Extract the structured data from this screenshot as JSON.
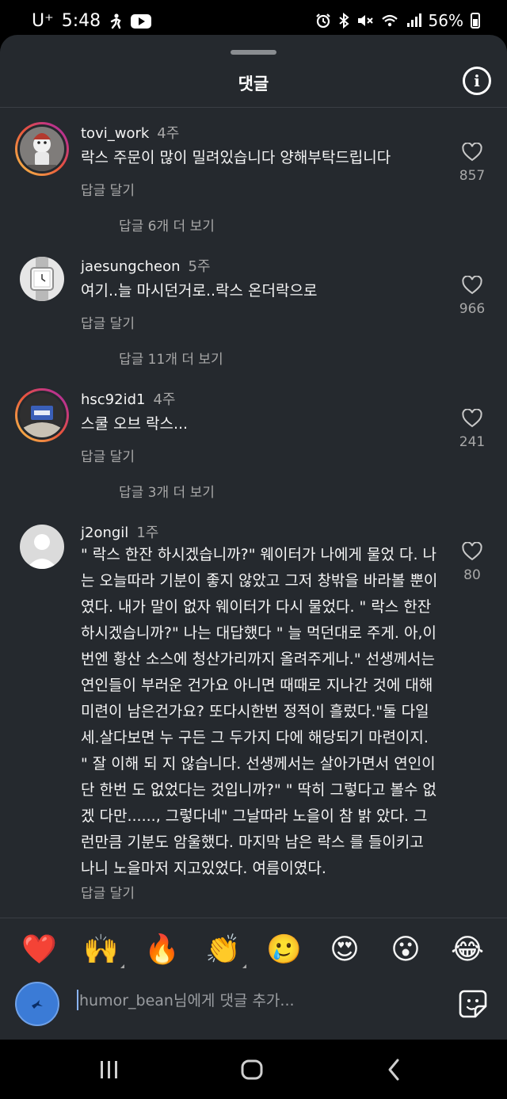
{
  "status_bar": {
    "carrier": "U⁺",
    "time": "5:48",
    "battery": "56%"
  },
  "sheet": {
    "title": "댓글"
  },
  "comments": [
    {
      "username": "tovi_work",
      "time": "4주",
      "text": "락스 주문이 많이 밀려있습니다 양해부탁드립니다",
      "reply_label": "답글 달기",
      "more_replies": "답글 6개 더 보기",
      "likes": "857"
    },
    {
      "username": "jaesungcheon",
      "time": "5주",
      "text": "여기..늘 마시던거로..락스 온더락으로",
      "reply_label": "답글 달기",
      "more_replies": "답글 11개 더 보기",
      "likes": "966"
    },
    {
      "username": "hsc92id1",
      "time": "4주",
      "text": "스쿨 오브 락스...",
      "reply_label": "답글 달기",
      "more_replies": "답글 3개 더 보기",
      "likes": "241"
    },
    {
      "username": "j2ongil",
      "time": "1주",
      "text": "\" 락스 한잔 하시겠습니까?\" 웨이터가 나에게 물었 다. 나는 오늘따라 기분이 좋지 않았고 그저 창밖을 바라볼 뿐이였다. 내가 말이 없자 웨이터가 다시 물었다. \" 락스 한잔 하시겠습니까?\" 나는 대답했다 \" 늘 먹던대로 주게. 아,이번엔 황산 소스에 청산가리까지 올려주게나.\" 선생께서는 연인들이 부러운 건가요 아니면 때때로 지나간 것에 대해 미련이 남은건가요? 또다시한번 정적이 흘렀다.\"둘 다일세.살다보면 누 구든 그 두가지 다에 해당되기 마련이지. \" 잘 이해 되 지 않습니다. 선생께서는 살아가면서 연인이 단 한번 도 없었다는 것입니까?\" \" 딱히 그렇다고 볼수 없겠 다만......, 그렇다네\" 그날따라 노을이 참 밝 았다. 그런만큼 기분도 암울했다. 마지막 남은 락스 를 들이키고 나니 노을마저 지고있었다. 여름이였다.",
      "reply_label": "답글 달기",
      "likes": "80"
    }
  ],
  "emoji_bar": [
    "❤️",
    "🙌",
    "🔥",
    "👏",
    "🥲",
    "😍",
    "😮",
    "😂"
  ],
  "input": {
    "placeholder": "humor_bean님에게 댓글 추가..."
  },
  "colors": {
    "sheet_bg": "#25292e",
    "text_primary": "#f5f5f5",
    "text_secondary": "#a8a8a8",
    "self_avatar": "#3b7bd6"
  }
}
